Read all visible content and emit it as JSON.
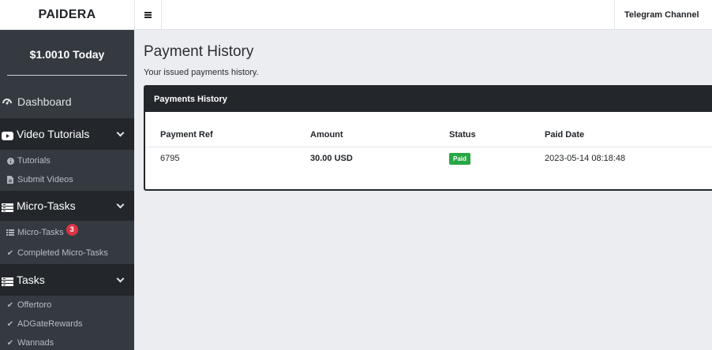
{
  "brand": "PAIDERA",
  "header": {
    "telegram_label": "Telegram Channel"
  },
  "sidebar": {
    "balance": "$1.0010 Today",
    "dashboard_label": "Dashboard",
    "sections": [
      {
        "label": "Video Tutorials",
        "items": [
          {
            "label": "Tutorials",
            "icon": "info-icon"
          },
          {
            "label": "Submit Videos",
            "icon": "document-icon"
          }
        ]
      },
      {
        "label": "Micro-Tasks",
        "items": [
          {
            "label": "Micro-Tasks",
            "icon": "list-icon",
            "badge": "3"
          },
          {
            "label": "Completed Micro-Tasks",
            "icon": "check-icon"
          }
        ]
      },
      {
        "label": "Tasks",
        "items": [
          {
            "label": "Offertoro",
            "icon": "check-icon"
          },
          {
            "label": "ADGateRewards",
            "icon": "check-icon"
          },
          {
            "label": "Wannads",
            "icon": "check-icon"
          }
        ]
      }
    ]
  },
  "main": {
    "title": "Payment History",
    "subtitle": "Your issued payments history.",
    "card_title": "Payments History",
    "columns": [
      "Payment Ref",
      "Amount",
      "Status",
      "Paid Date"
    ],
    "rows": [
      {
        "ref": "6795",
        "amount": "30.00 USD",
        "status": "Paid",
        "date": "2023-05-14 08:18:48"
      }
    ]
  },
  "colors": {
    "sidebar_bg": "#343a40",
    "section_bg": "#23272b",
    "badge_red": "#dc3545",
    "status_green": "#28a745"
  }
}
